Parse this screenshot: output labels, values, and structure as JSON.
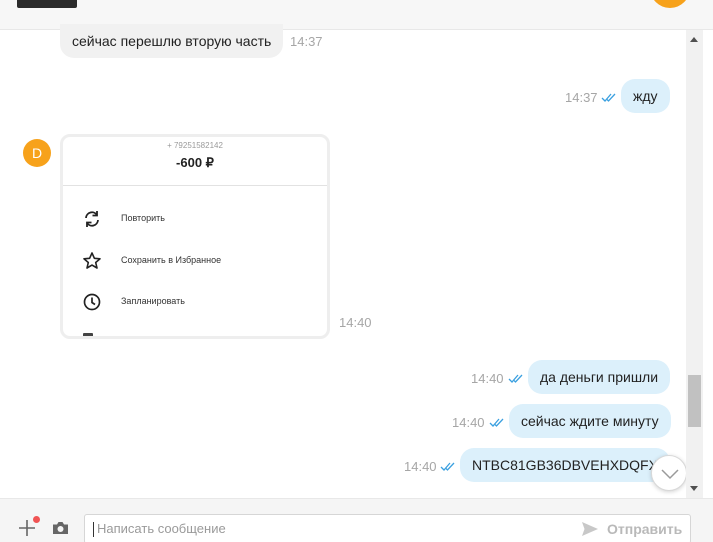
{
  "messages": {
    "m1": {
      "text": "сейчас перешлю вторую часть",
      "time": "14:37"
    },
    "m2": {
      "text": "жду",
      "time": "14:37"
    },
    "m3": {
      "time": "14:40"
    },
    "m4": {
      "text": "да деньги пришли",
      "time": "14:40"
    },
    "m5": {
      "text": "сейчас ждите минуту",
      "time": "14:40"
    },
    "m6": {
      "text": "NTBC81GB36DBVEHXDQFX",
      "time": "14:40"
    }
  },
  "sender": {
    "initial": "D",
    "avatar_color": "#f7a21b"
  },
  "card": {
    "phone": "+ 79251582142",
    "amount": "-600 ₽",
    "actions": [
      {
        "label": "Повторить",
        "icon": "repeat-icon"
      },
      {
        "label": "Сохранить в Избранное",
        "icon": "star-icon"
      },
      {
        "label": "Запланировать",
        "icon": "clock-icon"
      }
    ]
  },
  "composer": {
    "placeholder": "Написать сообщение",
    "send_label": "Отправить"
  },
  "colors": {
    "outgoing_bubble": "#dcf0fb",
    "incoming_bubble": "#f1f1f1",
    "read_checks": "#3aa0e0",
    "accent_avatar": "#f7a21b",
    "attach_badge": "#f05454"
  }
}
